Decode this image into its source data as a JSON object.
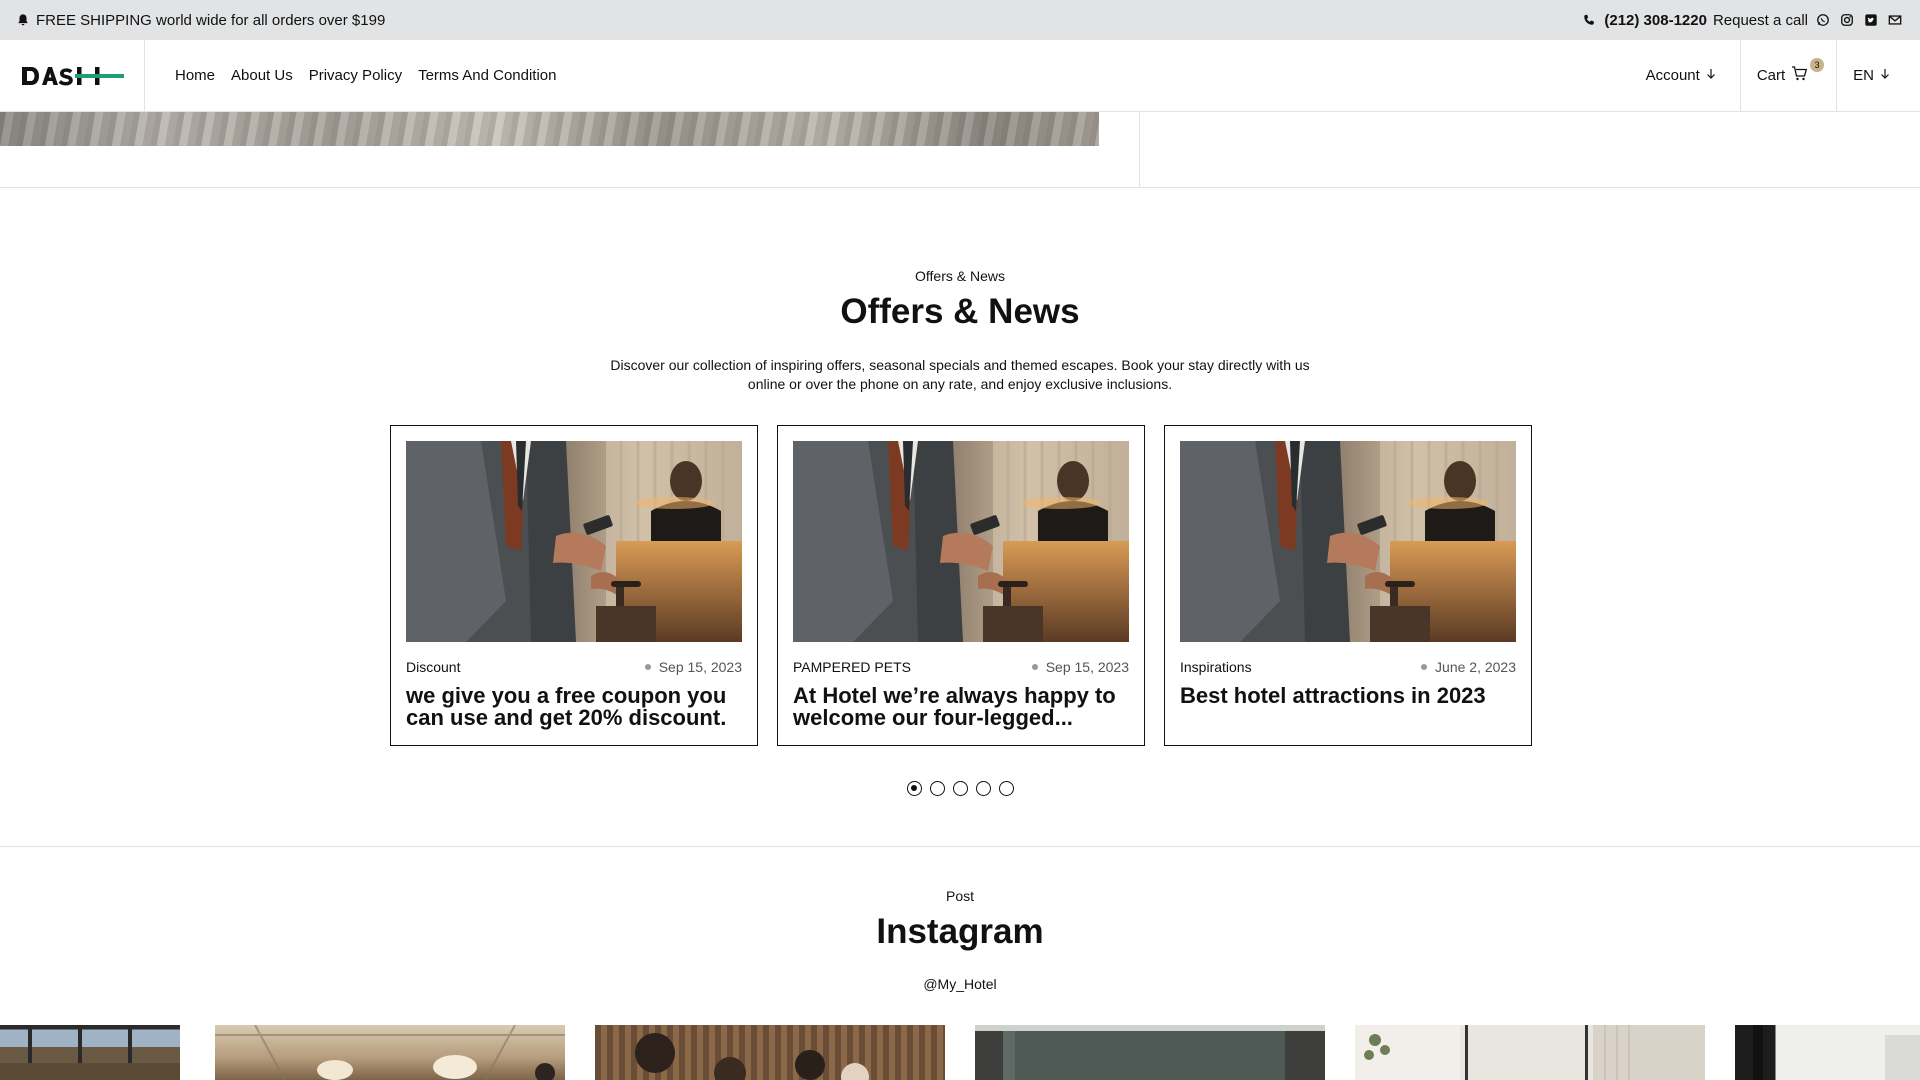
{
  "topbar": {
    "shipping": "FREE SHIPPING world wide for all orders over $199",
    "phone": "(212) 308-1220",
    "request_call": "Request a call",
    "social_icons": [
      "whatsapp-icon",
      "instagram-icon",
      "twitter-icon",
      "mail-icon"
    ]
  },
  "header": {
    "logo_text": "DASH",
    "nav": [
      "Home",
      "About Us",
      "Privacy Policy",
      "Terms And Condition"
    ],
    "account": "Account",
    "cart": "Cart",
    "cart_count": "3",
    "language": "EN"
  },
  "offers": {
    "eyebrow": "Offers & News",
    "title": "Offers & News",
    "description": "Discover our collection of inspiring offers, seasonal specials and themed escapes. Book your stay directly with us online or over the phone on any rate, and enjoy exclusive inclusions.",
    "cards": [
      {
        "category": "Discount",
        "date": "Sep 15, 2023",
        "title": "we give you a free coupon you can use and get 20% discount."
      },
      {
        "category": "PAMPERED PETS",
        "date": "Sep 15, 2023",
        "title": "At Hotel we’re always happy to welcome our four-legged..."
      },
      {
        "category": "Inspirations",
        "date": "June 2, 2023",
        "title": "Best hotel attractions in 2023"
      }
    ],
    "pagination": {
      "total": 5,
      "active": 1
    }
  },
  "instagram": {
    "eyebrow": "Post",
    "title": "Instagram",
    "handle": "@My_Hotel"
  },
  "colors": {
    "topbar_bg": "#e2e3e4",
    "logo_accent": "#1f9e6e",
    "border": "#e3e3e3",
    "cart_badge": "#c8b38a"
  }
}
